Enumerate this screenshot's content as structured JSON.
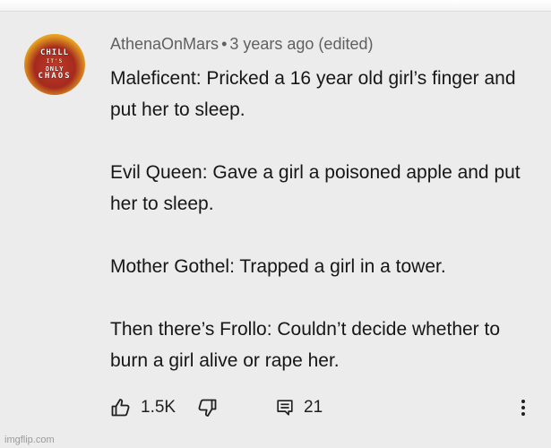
{
  "comment": {
    "author": "AthenaOnMars",
    "separator": "•",
    "timestamp": "3 years ago (edited)",
    "paragraphs": [
      "Maleficent: Pricked a 16 year old girl’s finger and put her to sleep.",
      "Evil Queen: Gave a girl a poisoned apple and put her to sleep.",
      "Mother Gothel: Trapped a girl in a tower.",
      "Then there’s Frollo: Couldn’t decide whether to burn a girl alive or rape her."
    ],
    "likes": "1.5K",
    "replies": "21"
  },
  "avatar": {
    "words": [
      "CHILL",
      "IT'S",
      "ONLY",
      "CHAOS"
    ]
  },
  "icons": {
    "like": "thumbs-up-icon",
    "dislike": "thumbs-down-icon",
    "reply": "reply-comment-icon",
    "more": "vertical-dots-icon"
  },
  "watermark": "imgflip.com"
}
